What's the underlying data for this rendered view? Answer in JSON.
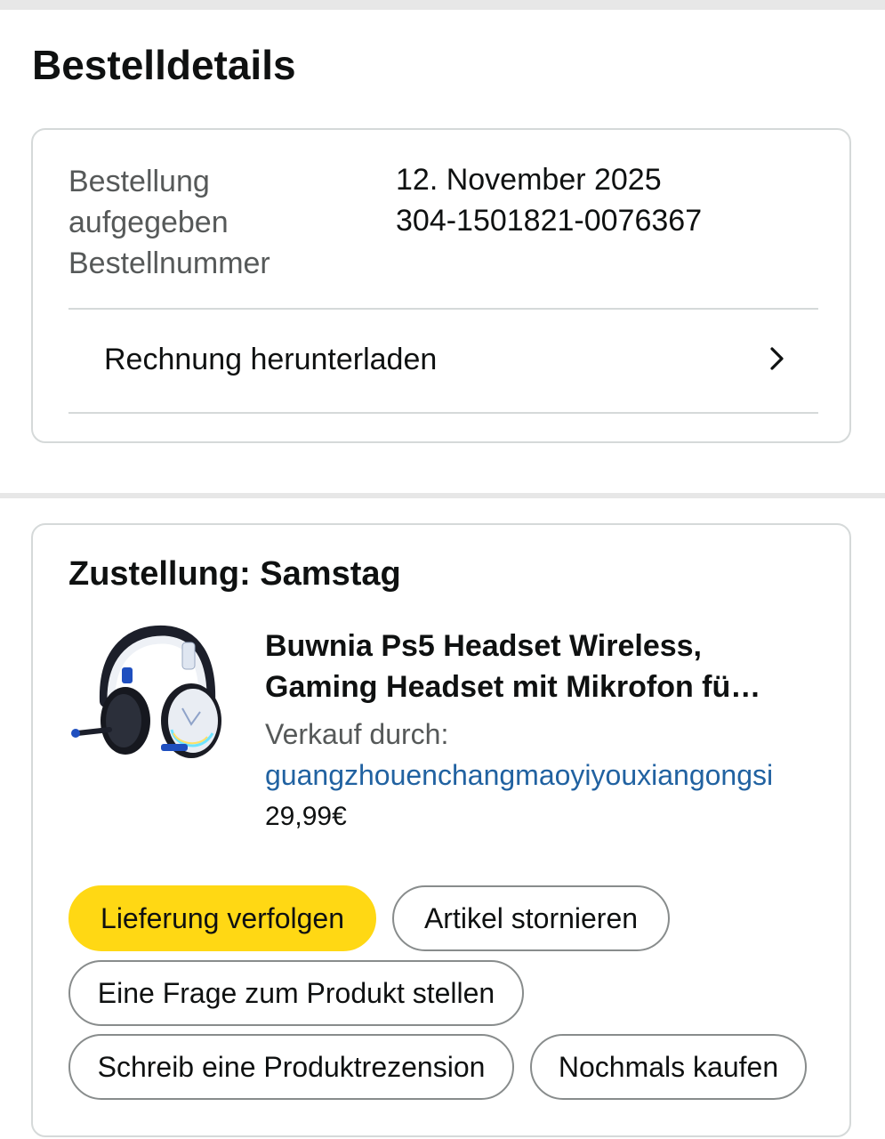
{
  "page": {
    "title": "Bestelldetails"
  },
  "order": {
    "placed_label": "Bestellung aufgegeben",
    "number_label": "Bestellnummer",
    "placed_date": "12. November 2025",
    "order_number": "304-1501821-0076367",
    "invoice_label": "Rechnung herunterladen"
  },
  "delivery": {
    "title": "Zustellung: Samstag",
    "product": {
      "image_name": "headset-product-image",
      "title_line1": "Buwnia Ps5 Headset Wireless,",
      "title_line2": "Gaming Headset mit Mikrofon fü…",
      "sold_by_label": "Verkauf durch:",
      "seller": "guangzhouenchangmaoyiyouxiangongsi",
      "price": "29,99€"
    },
    "actions": {
      "track": "Lieferung verfolgen",
      "cancel": "Artikel stornieren",
      "question": "Eine Frage zum Produkt stellen",
      "review": "Schreib eine Produktrezension",
      "buy_again": "Nochmals kaufen"
    }
  },
  "colors": {
    "primary_button": "#ffd814",
    "link": "#2162a1",
    "muted_text": "#565959",
    "border": "#d5d9d9"
  }
}
